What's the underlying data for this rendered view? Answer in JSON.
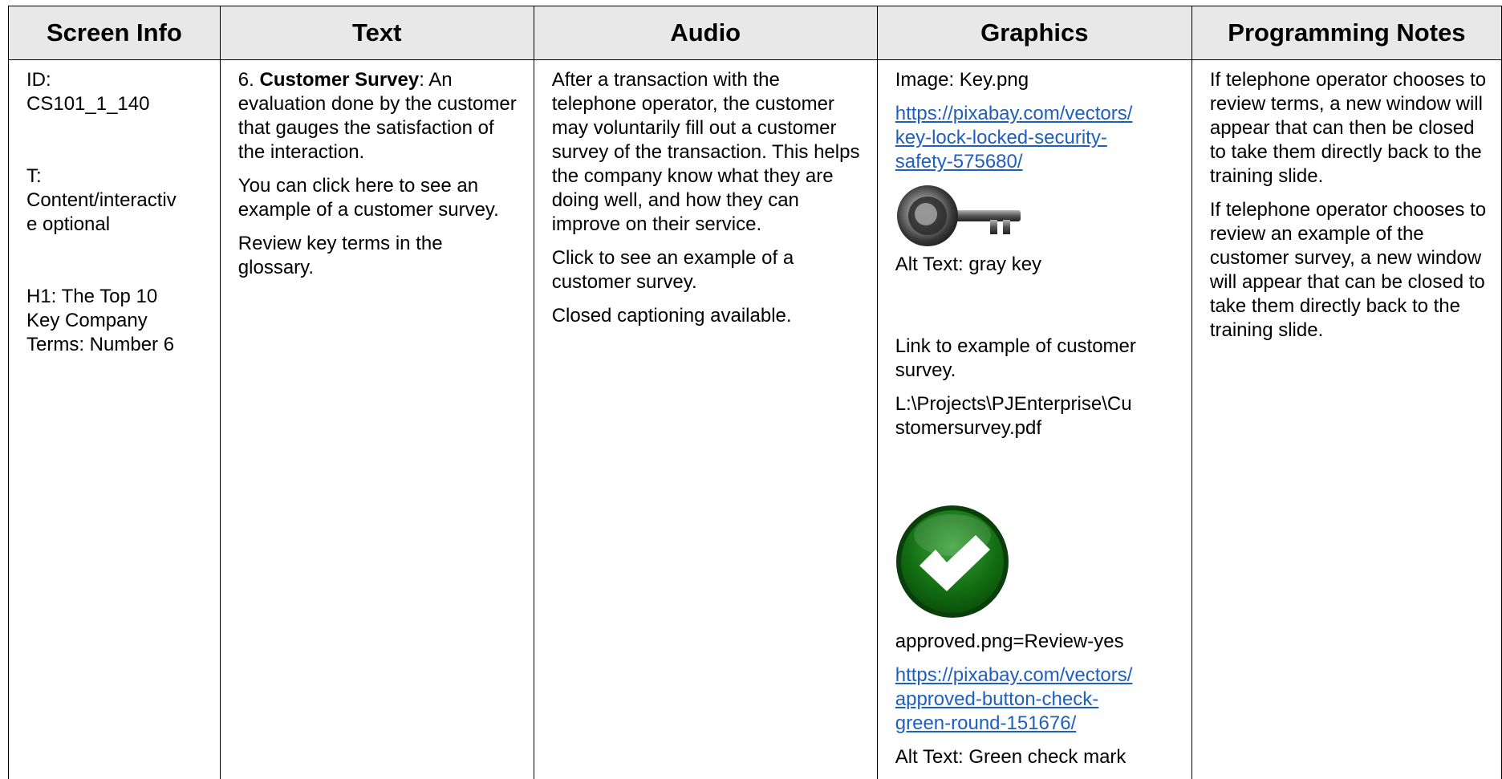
{
  "headers": [
    "Screen Info",
    "Text",
    "Audio",
    "Graphics",
    "Programming Notes"
  ],
  "screen_info": {
    "id_label": "ID:",
    "id_value": "CS101_1_140",
    "type_label": "T:",
    "type_value_1": "Content/interactiv",
    "type_value_2": "e optional",
    "h1_1": "H1: The Top 10",
    "h1_2": "Key Company",
    "h1_3": "Terms: Number 6"
  },
  "text_col": {
    "number": "6. ",
    "term": "Customer Survey",
    "definition": ": An evaluation done by the customer that gauges the satisfaction of the interaction.",
    "p2": "You can click here to see an example of a customer survey.",
    "p3": "Review key terms in the glossary."
  },
  "audio": {
    "p1": "After a transaction with the telephone operator, the customer may voluntarily fill out a customer survey of the transaction. This helps the company know what they are doing well, and how they can improve on their service.",
    "p2": "Click to see an example of a customer survey.",
    "p3": "Closed captioning available."
  },
  "graphics": {
    "image1": "Image: Key.png",
    "link1_1": "https://pixabay.com/vectors/",
    "link1_2": "key-lock-locked-security-",
    "link1_3": "safety-575680/",
    "icon1": "key-icon",
    "alt1": "Alt Text: gray key",
    "link_text": "Link to example of customer survey.",
    "path_1": "L:\\Projects\\PJEnterprise\\Cu",
    "path_2": "stomersurvey.pdf",
    "icon2": "checkmark-icon",
    "image2": "approved.png=Review-yes",
    "link2_1": "https://pixabay.com/vectors/",
    "link2_2": "approved-button-check-",
    "link2_3": "green-round-151676/",
    "alt2": "Alt Text: Green check mark"
  },
  "programming": {
    "p1": "If telephone operator chooses to review terms, a new window will appear that can then be closed to take them directly back to the training slide.",
    "p2": "If telephone operator chooses to review an example of the customer survey, a new window will appear that can be closed to take them directly back to the training slide."
  },
  "colors": {
    "header_bg": "#e8e8e8",
    "link": "#1f5fbf",
    "check_green": "#1a7a1a"
  }
}
